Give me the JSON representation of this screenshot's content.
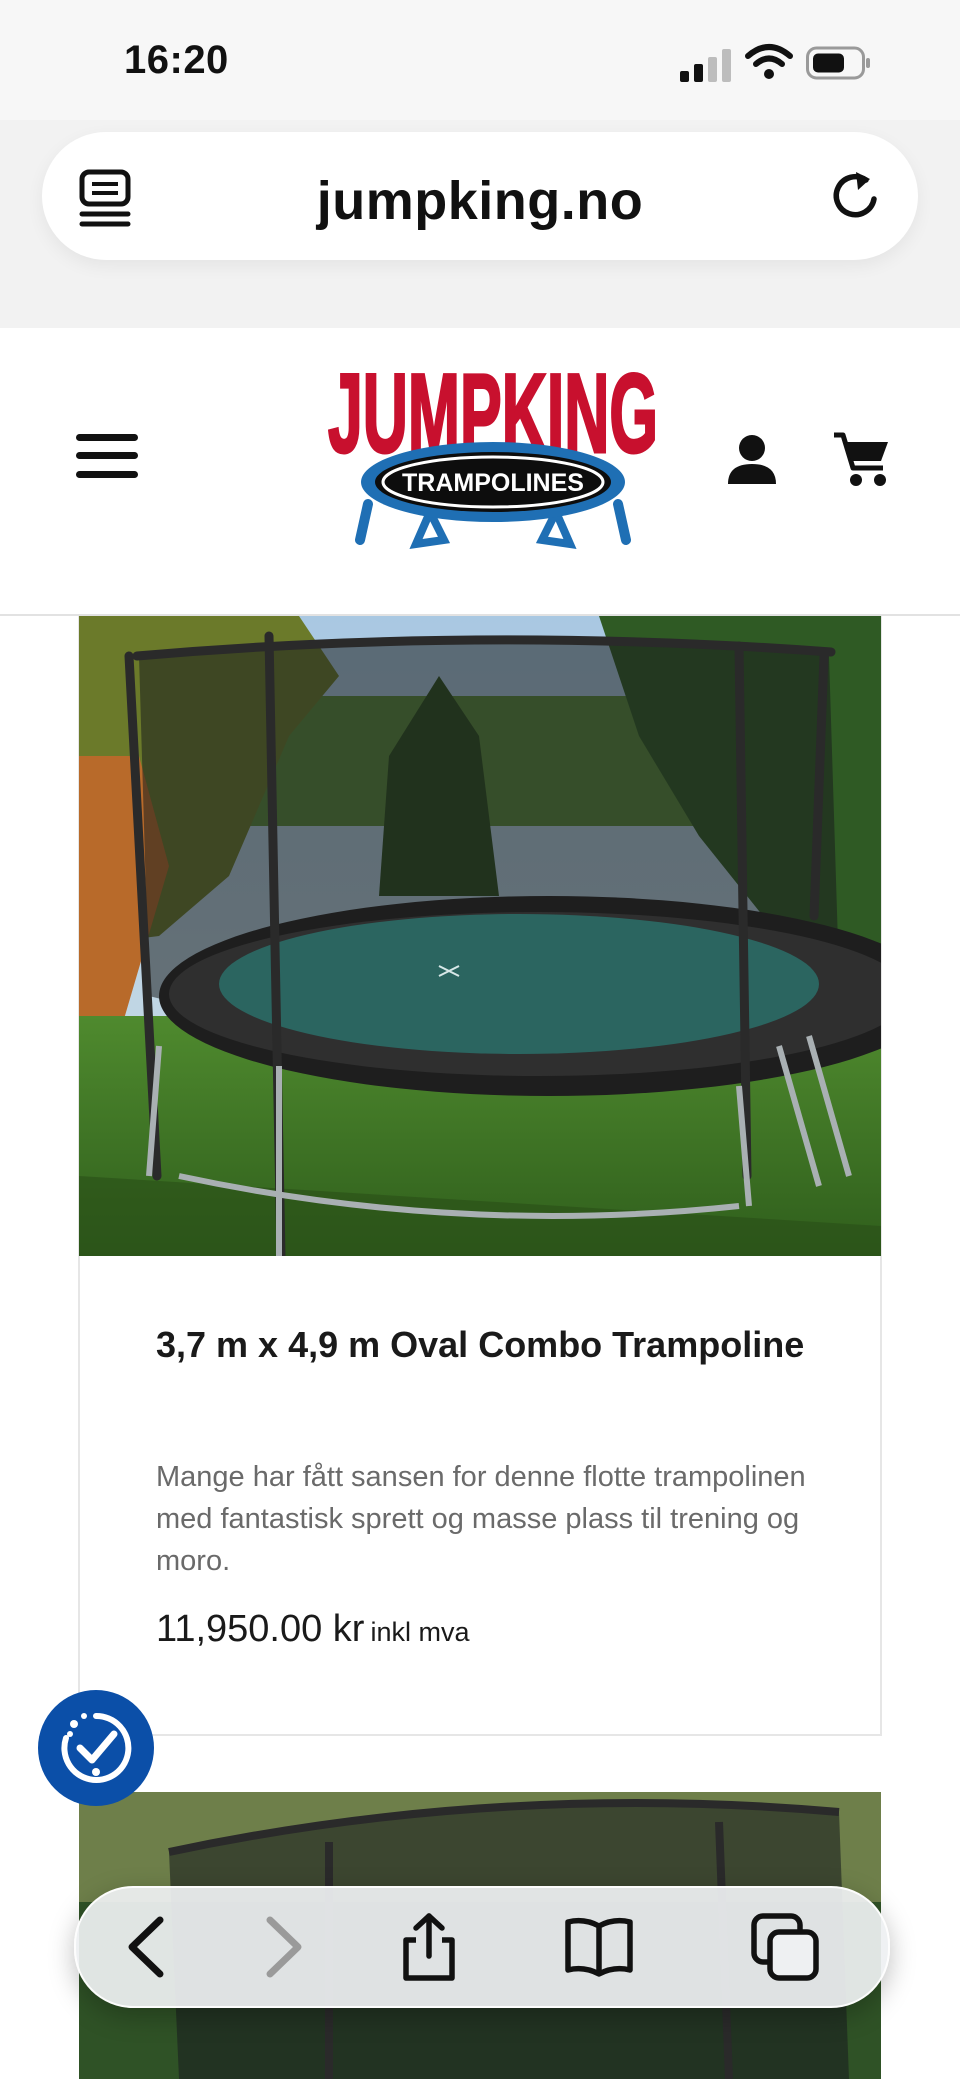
{
  "status_bar": {
    "time": "16:20"
  },
  "browser": {
    "url": "jumpking.no"
  },
  "logo": {
    "brand": "JUMPKING",
    "tagline": "TRAMPOLINES"
  },
  "product": {
    "title": "3,7 m x 4,9 m Oval Combo Trampoline",
    "description": "Mange har fått sansen for denne flotte trampolinen med fantastisk sprett og masse plass til trening og moro.",
    "price": "11,950.00 kr",
    "price_suffix": "inkl mva"
  },
  "colors": {
    "brand_red": "#c8102e",
    "brand_blue": "#1f6fb4",
    "accessibility_blue": "#0b4fa8"
  },
  "icons": [
    "signal-icon",
    "wifi-icon",
    "battery-icon",
    "reader-icon",
    "reload-icon",
    "menu-icon",
    "user-icon",
    "cart-icon",
    "accessibility-icon",
    "back-icon",
    "forward-icon",
    "share-icon",
    "bookmarks-icon",
    "tabs-icon"
  ]
}
